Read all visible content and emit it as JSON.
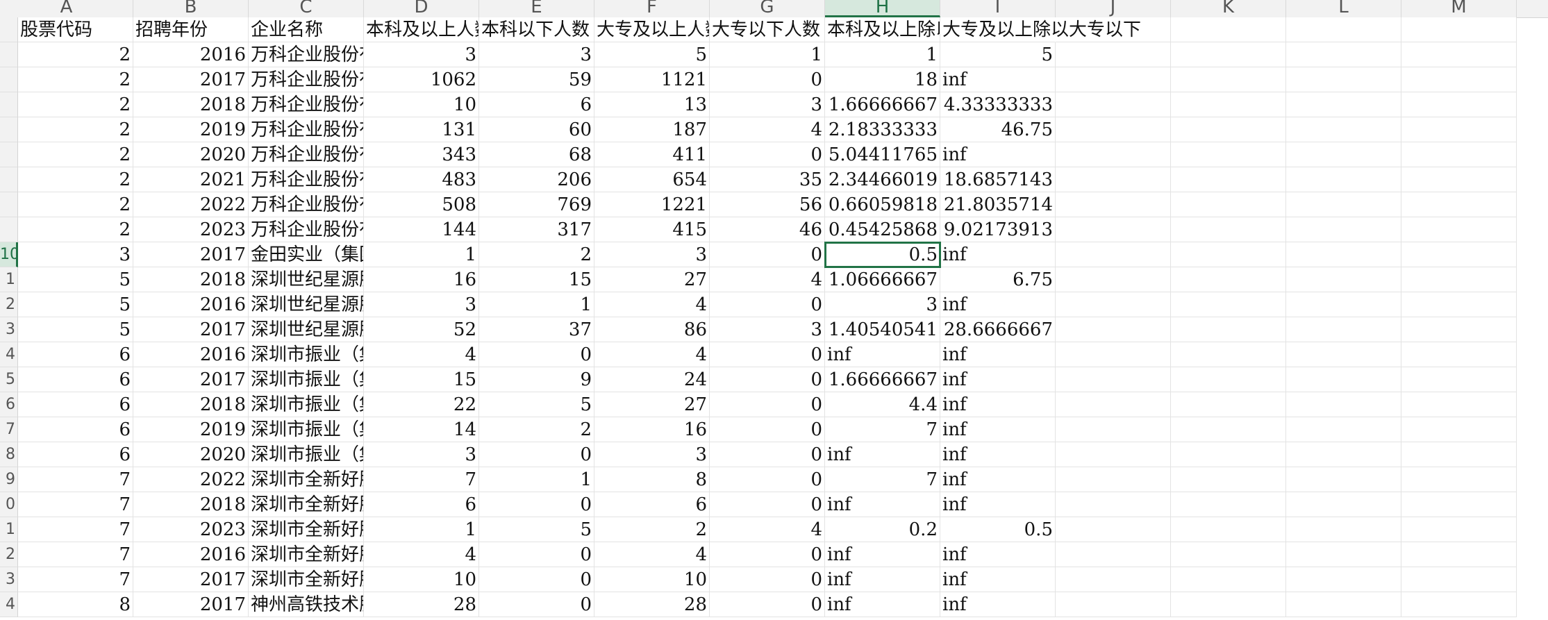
{
  "columns": [
    "A",
    "B",
    "C",
    "D",
    "E",
    "F",
    "G",
    "H",
    "I",
    "J",
    "K",
    "L",
    "M"
  ],
  "active_column": "H",
  "active_row": "10",
  "header_row": {
    "stock_code": "股票代码",
    "year": "招聘年份",
    "company": "企业名称",
    "bachelor_above": "本科及以上人数",
    "bachelor_below": "本科以下人数",
    "college_above": "大专及以上人数",
    "college_below": "大专以下人数",
    "ratio_bachelor": "本科及以上除以本科以下",
    "ratio_college": "大专及以上除以大专以下"
  },
  "row_numbers": [
    "10",
    "1",
    "2",
    "3",
    "4",
    "5",
    "6",
    "7",
    "8",
    "9",
    "0",
    "1",
    "2",
    "3",
    "4"
  ],
  "rows": [
    {
      "code": "2",
      "year": "2016",
      "company": "万科企业股份有限公司",
      "d": "3",
      "e": "3",
      "f": "5",
      "g": "1",
      "h": "1",
      "i": "5"
    },
    {
      "code": "2",
      "year": "2017",
      "company": "万科企业股份有限公司",
      "d": "1062",
      "e": "59",
      "f": "1121",
      "g": "0",
      "h": "18",
      "i": "inf"
    },
    {
      "code": "2",
      "year": "2018",
      "company": "万科企业股份有限公司",
      "d": "10",
      "e": "6",
      "f": "13",
      "g": "3",
      "h": "1.66666667",
      "i": "4.33333333"
    },
    {
      "code": "2",
      "year": "2019",
      "company": "万科企业股份有限公司",
      "d": "131",
      "e": "60",
      "f": "187",
      "g": "4",
      "h": "2.18333333",
      "i": "46.75"
    },
    {
      "code": "2",
      "year": "2020",
      "company": "万科企业股份有限公司",
      "d": "343",
      "e": "68",
      "f": "411",
      "g": "0",
      "h": "5.04411765",
      "i": "inf"
    },
    {
      "code": "2",
      "year": "2021",
      "company": "万科企业股份有限公司",
      "d": "483",
      "e": "206",
      "f": "654",
      "g": "35",
      "h": "2.34466019",
      "i": "18.6857143"
    },
    {
      "code": "2",
      "year": "2022",
      "company": "万科企业股份有限公司",
      "d": "508",
      "e": "769",
      "f": "1221",
      "g": "56",
      "h": "0.66059818",
      "i": "21.8035714"
    },
    {
      "code": "2",
      "year": "2023",
      "company": "万科企业股份有限公司",
      "d": "144",
      "e": "317",
      "f": "415",
      "g": "46",
      "h": "0.45425868",
      "i": "9.02173913"
    },
    {
      "code": "3",
      "year": "2017",
      "company": "金田实业（集团）股份有限公司",
      "d": "1",
      "e": "2",
      "f": "3",
      "g": "0",
      "h": "0.5",
      "i": "inf"
    },
    {
      "code": "5",
      "year": "2018",
      "company": "深圳世纪星源股份有限公司",
      "d": "16",
      "e": "15",
      "f": "27",
      "g": "4",
      "h": "1.06666667",
      "i": "6.75"
    },
    {
      "code": "5",
      "year": "2016",
      "company": "深圳世纪星源股份有限公司",
      "d": "3",
      "e": "1",
      "f": "4",
      "g": "0",
      "h": "3",
      "i": "inf"
    },
    {
      "code": "5",
      "year": "2017",
      "company": "深圳世纪星源股份有限公司",
      "d": "52",
      "e": "37",
      "f": "86",
      "g": "3",
      "h": "1.40540541",
      "i": "28.6666667"
    },
    {
      "code": "6",
      "year": "2016",
      "company": "深圳市振业（集团）股份有限公司",
      "d": "4",
      "e": "0",
      "f": "4",
      "g": "0",
      "h": "inf",
      "i": "inf"
    },
    {
      "code": "6",
      "year": "2017",
      "company": "深圳市振业（集团）股份有限公司",
      "d": "15",
      "e": "9",
      "f": "24",
      "g": "0",
      "h": "1.66666667",
      "i": "inf"
    },
    {
      "code": "6",
      "year": "2018",
      "company": "深圳市振业（集团）股份有限公司",
      "d": "22",
      "e": "5",
      "f": "27",
      "g": "0",
      "h": "4.4",
      "i": "inf"
    },
    {
      "code": "6",
      "year": "2019",
      "company": "深圳市振业（集团）股份有限公司",
      "d": "14",
      "e": "2",
      "f": "16",
      "g": "0",
      "h": "7",
      "i": "inf"
    },
    {
      "code": "6",
      "year": "2020",
      "company": "深圳市振业（集团）股份有限公司",
      "d": "3",
      "e": "0",
      "f": "3",
      "g": "0",
      "h": "inf",
      "i": "inf"
    },
    {
      "code": "7",
      "year": "2022",
      "company": "深圳市全新好股份有限公司",
      "d": "7",
      "e": "1",
      "f": "8",
      "g": "0",
      "h": "7",
      "i": "inf"
    },
    {
      "code": "7",
      "year": "2018",
      "company": "深圳市全新好股份有限公司",
      "d": "6",
      "e": "0",
      "f": "6",
      "g": "0",
      "h": "inf",
      "i": "inf"
    },
    {
      "code": "7",
      "year": "2023",
      "company": "深圳市全新好股份有限公司",
      "d": "1",
      "e": "5",
      "f": "2",
      "g": "4",
      "h": "0.2",
      "i": "0.5"
    },
    {
      "code": "7",
      "year": "2016",
      "company": "深圳市全新好股份有限公司",
      "d": "4",
      "e": "0",
      "f": "4",
      "g": "0",
      "h": "inf",
      "i": "inf"
    },
    {
      "code": "7",
      "year": "2017",
      "company": "深圳市全新好股份有限公司",
      "d": "10",
      "e": "0",
      "f": "10",
      "g": "0",
      "h": "inf",
      "i": "inf"
    },
    {
      "code": "8",
      "year": "2017",
      "company": "神州高铁技术股份有限公司",
      "d": "28",
      "e": "0",
      "f": "28",
      "g": "0",
      "h": "inf",
      "i": "inf"
    }
  ]
}
